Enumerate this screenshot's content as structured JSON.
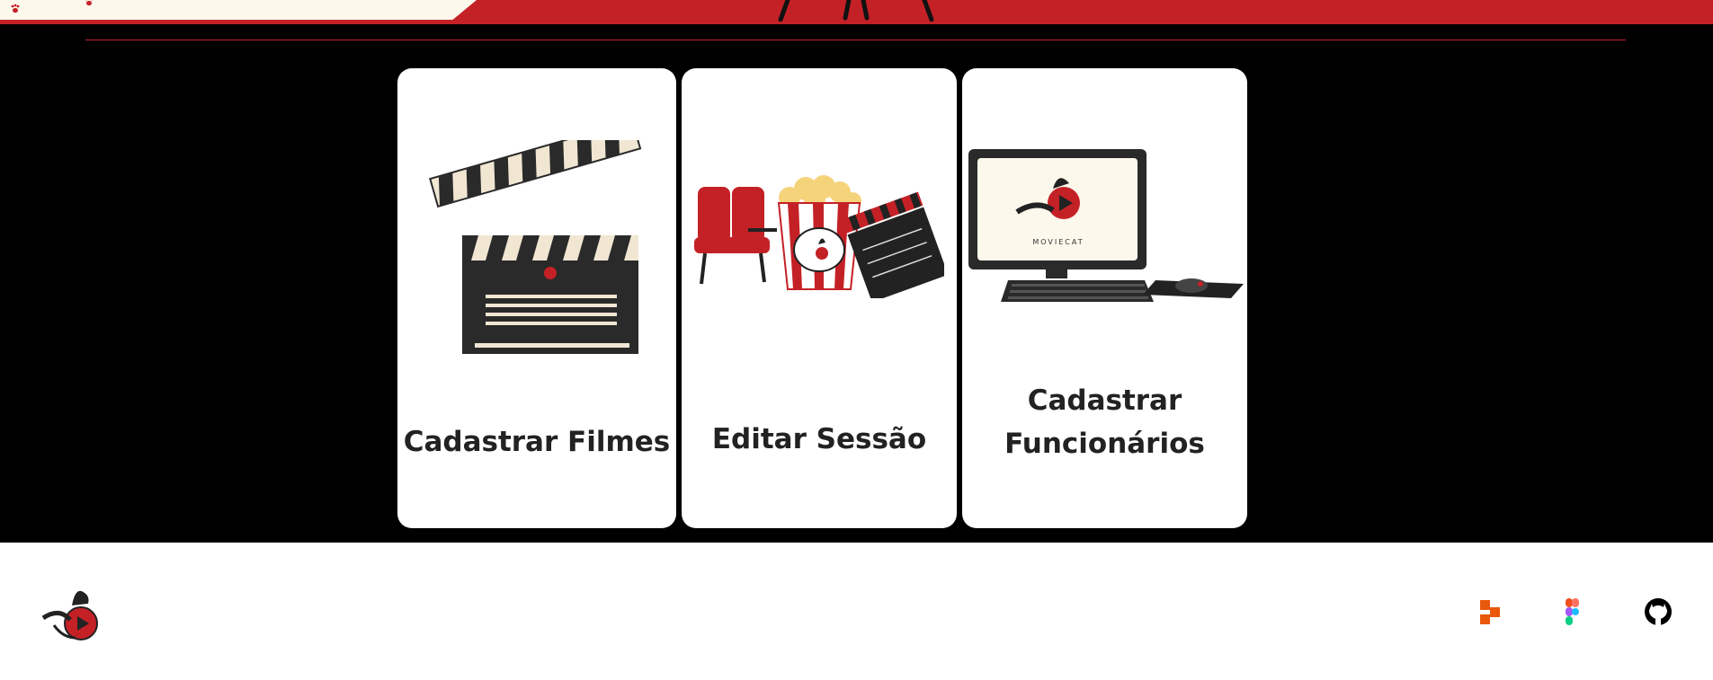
{
  "colors": {
    "brand_red": "#c42127",
    "cream": "#fdf8ec",
    "background": "#000000",
    "card_background": "#ffffff",
    "text_dark": "#222222"
  },
  "header": {
    "decoration": [
      "paw-icon",
      "paw-icon",
      "film-legs-graphic"
    ]
  },
  "cards": [
    {
      "label": "Cadastrar Filmes",
      "icon": "clapperboard-icon"
    },
    {
      "label": "Editar Sessão",
      "icon": "cinema-seats-popcorn-icon"
    },
    {
      "label": "Cadastrar Funcionários",
      "icon": "computer-moviecat-icon"
    }
  ],
  "computer_screen_brand": "MOVIECAT",
  "footer": {
    "logo": "moviecat-logo",
    "links": [
      {
        "icon": "trello-icon"
      },
      {
        "icon": "figma-icon"
      },
      {
        "icon": "github-icon"
      }
    ]
  }
}
